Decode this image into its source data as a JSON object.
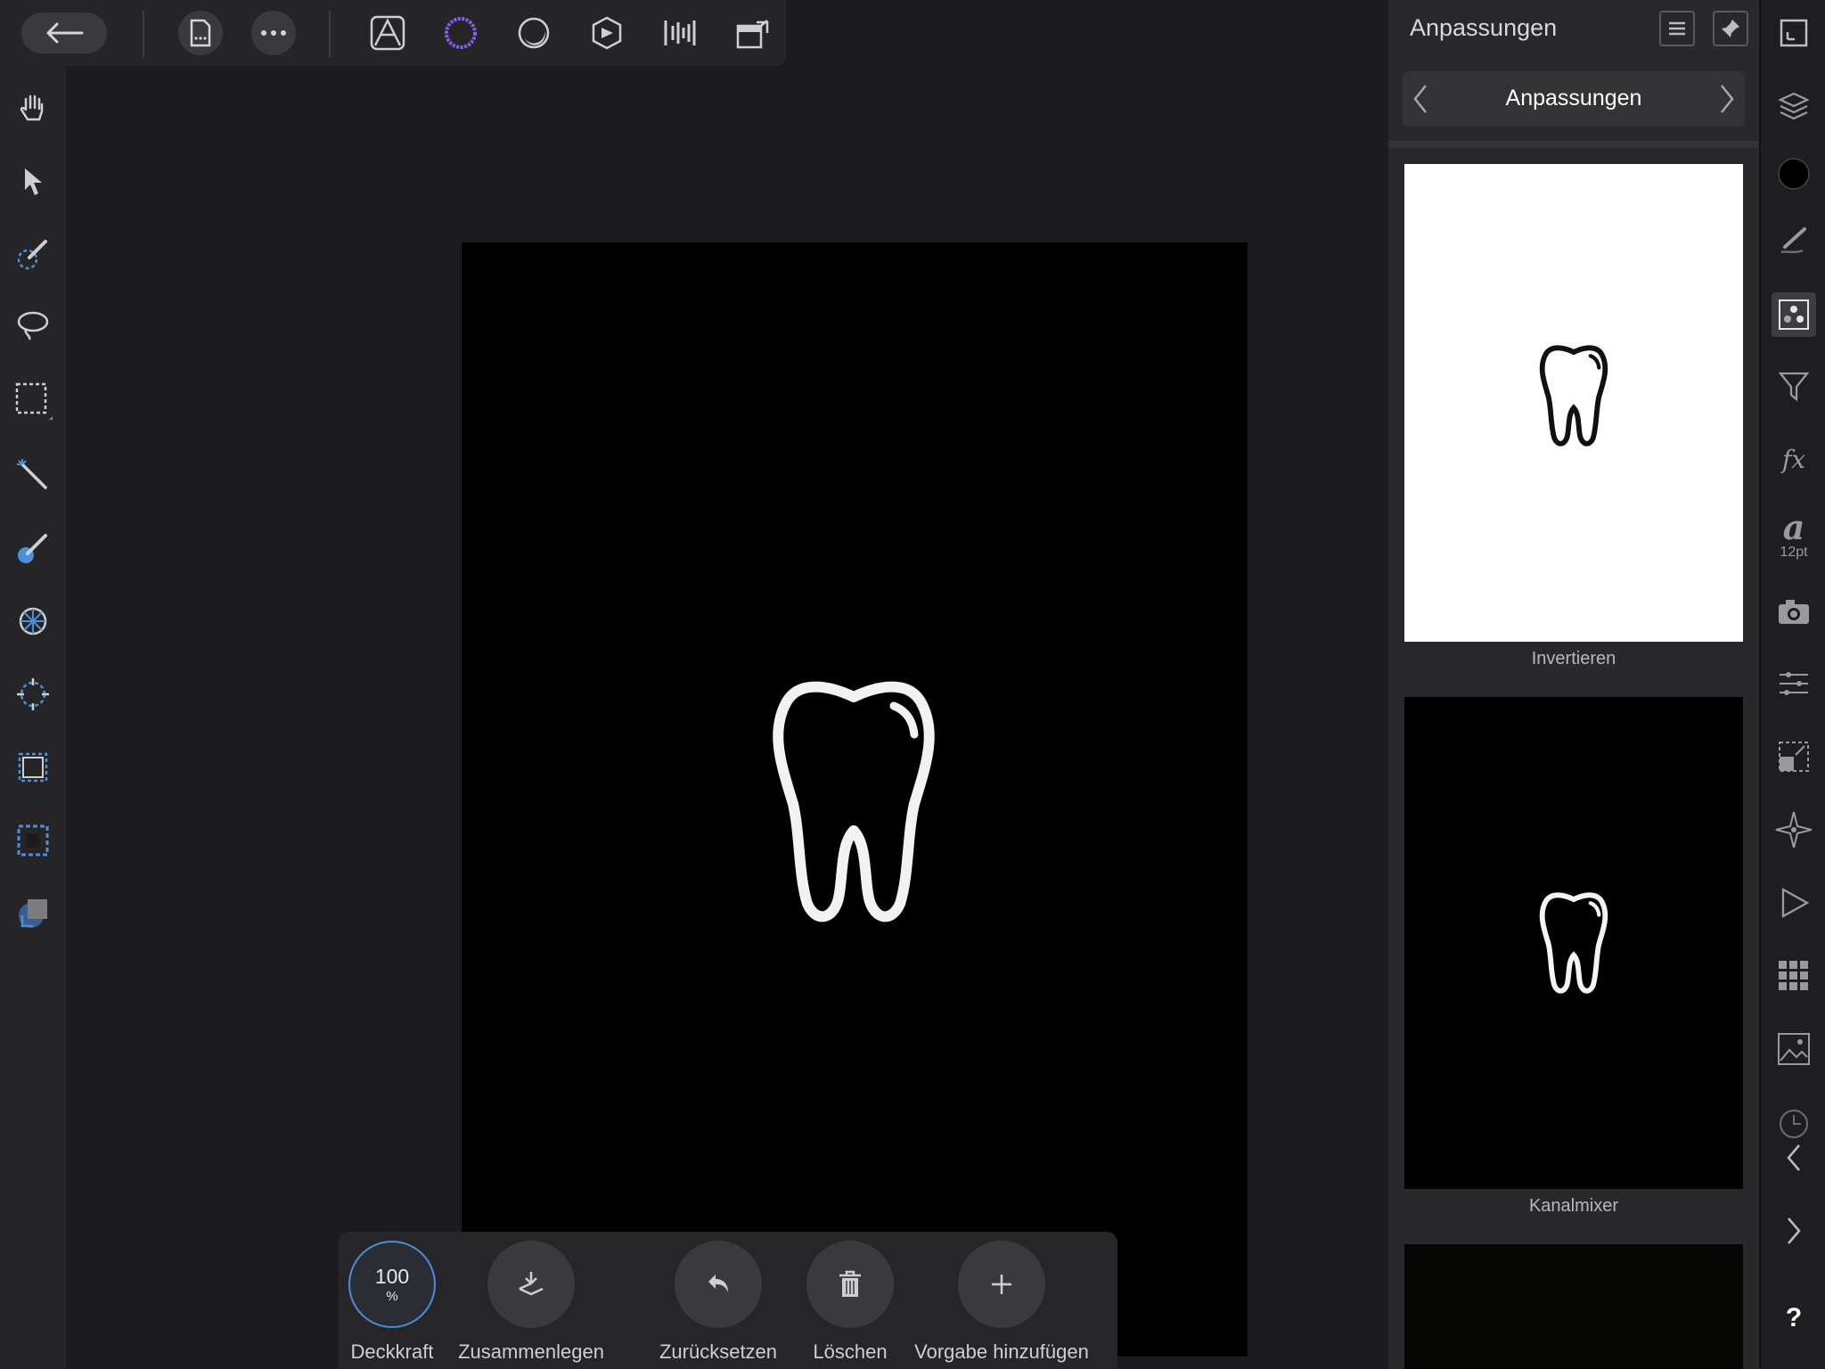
{
  "toolbar": {
    "back_label": "Back",
    "document_icon": "document-icon",
    "more_icon": "more-icon",
    "personas": [
      "photo-persona-icon",
      "liquify-persona-icon",
      "develop-persona-icon",
      "tone-mapping-persona-icon",
      "export-persona-icon",
      "studio-link-icon"
    ]
  },
  "tools": [
    "hand-tool-icon",
    "move-tool-icon",
    "selection-brush-icon",
    "freehand-selection-icon",
    "marquee-selection-icon",
    "flood-select-icon",
    "brush-tool-icon",
    "retouch-tool-icon",
    "burn-tool-icon",
    "crop-tool-icon",
    "view-tool-icon",
    "shape-tool-icon"
  ],
  "bottom_bar": {
    "opacity_value": "100",
    "opacity_unit": "%",
    "opacity_label": "Deckkraft",
    "merge_label": "Zusammenlegen",
    "reset_label": "Zurücksetzen",
    "delete_label": "Löschen",
    "add_preset_label": "Vorgabe hinzufügen"
  },
  "panel": {
    "title": "Anpassungen",
    "category": "Anpassungen",
    "presets": [
      {
        "label": "Invertieren",
        "bg": "#ffffff",
        "fg": "#111111"
      },
      {
        "label": "Kanalmixer",
        "bg": "#000000",
        "fg": "#f4f4f4"
      },
      {
        "label": "",
        "bg": "#060704",
        "fg": ""
      }
    ]
  },
  "right_strip": {
    "font_size_label": "12pt",
    "help_label": "?"
  },
  "colors": {
    "background": "#1c1c1e",
    "panel": "#29292b",
    "accent": "#4a90d9",
    "persona_accent": "#8a5cf6"
  }
}
